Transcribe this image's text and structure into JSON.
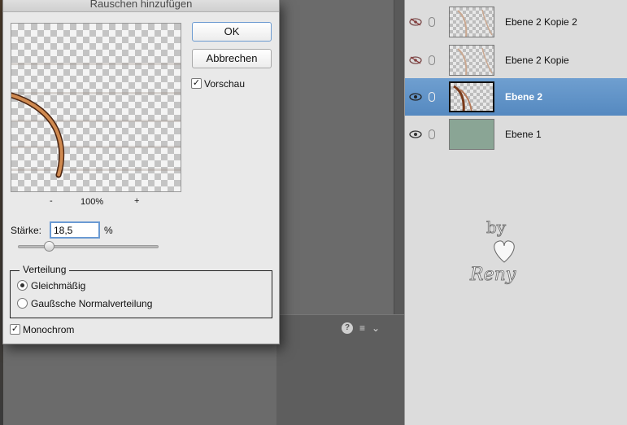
{
  "dialog": {
    "title": "Rauschen hinzufügen",
    "ok_label": "OK",
    "cancel_label": "Abbrechen",
    "preview_label": "Vorschau",
    "preview_checked": true,
    "zoom_minus": "-",
    "zoom_value": "100%",
    "zoom_plus": "+",
    "strength_label": "Stärke:",
    "strength_value": "18,5",
    "strength_unit": "%",
    "distribution_legend": "Verteilung",
    "distribution_options": [
      {
        "label": "Gleichmäßig",
        "selected": true
      },
      {
        "label": "Gaußsche Normalverteilung",
        "selected": false
      }
    ],
    "monochrome_label": "Monochrom",
    "monochrome_checked": true
  },
  "layers": [
    {
      "name": "Ebene 2 Kopie 2",
      "visible": false,
      "selected": false
    },
    {
      "name": "Ebene 2 Kopie",
      "visible": false,
      "selected": false
    },
    {
      "name": "Ebene 2",
      "visible": true,
      "selected": true
    },
    {
      "name": "Ebene 1",
      "visible": true,
      "selected": false
    }
  ],
  "panel_icons": {
    "help": "?",
    "list_menu": "≡",
    "collapse": "⌄"
  },
  "colors": {
    "selection": "#5a8cc4",
    "layer1_fill": "#8aa595",
    "ok_border": "#6d9bd1"
  }
}
